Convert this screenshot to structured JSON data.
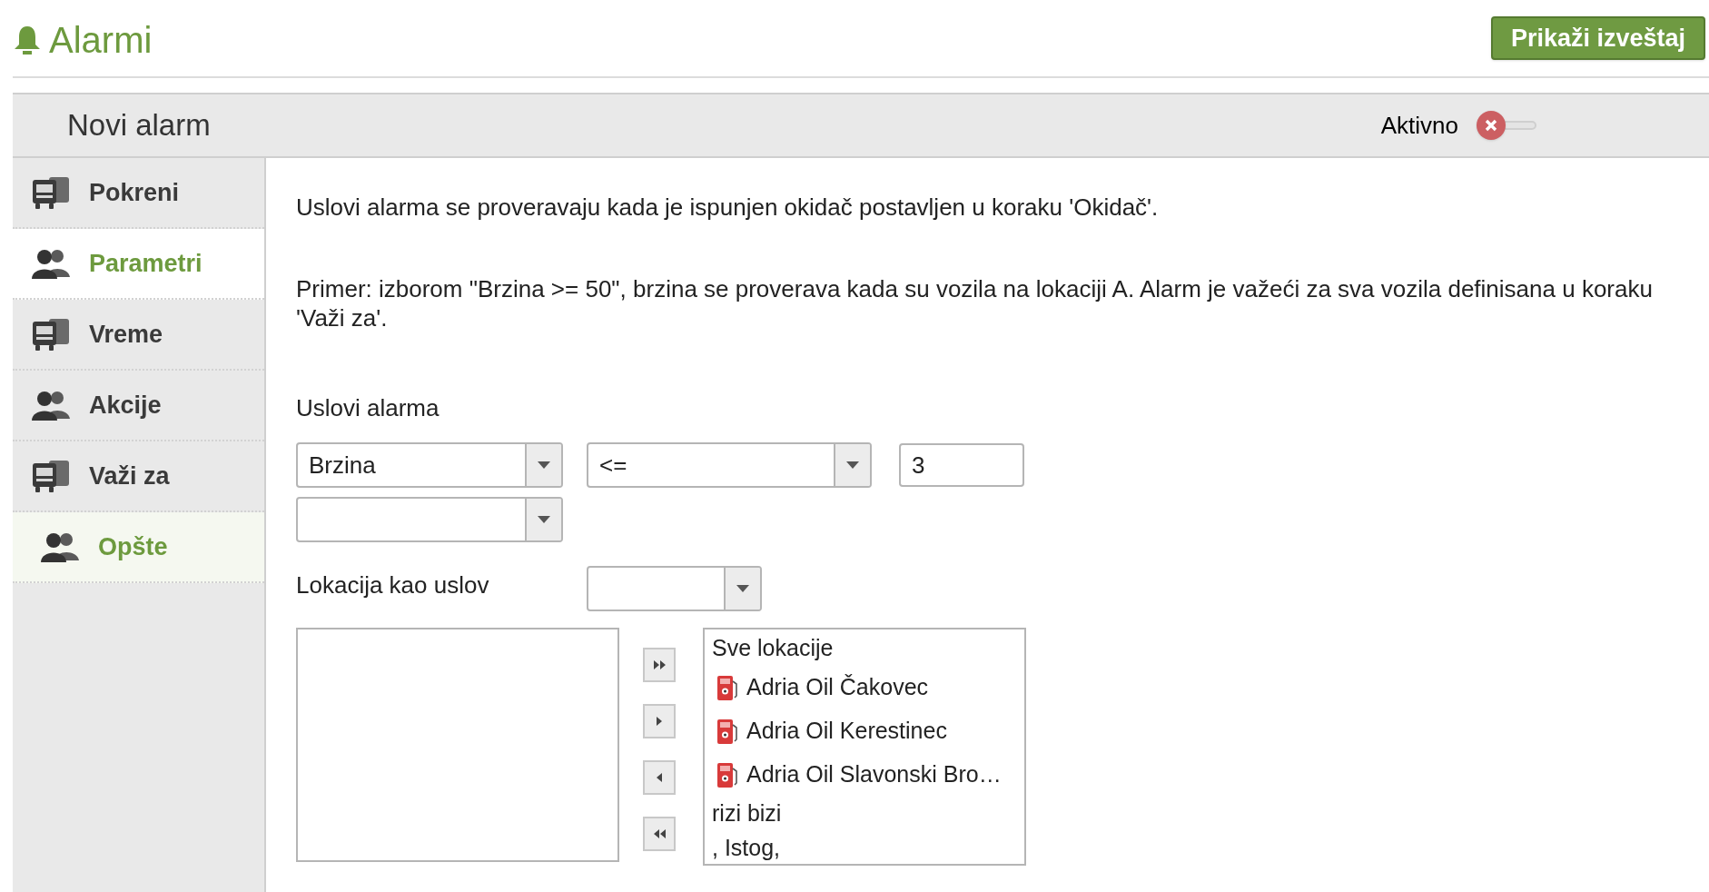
{
  "header": {
    "title": "Alarmi",
    "report_button": "Prikaži izveštaj"
  },
  "panel": {
    "title": "Novi alarm",
    "active_label": "Aktivno",
    "active_on": false
  },
  "sidebar": {
    "items": [
      {
        "label": "Pokreni",
        "kind": "truck",
        "selected": false,
        "highlighted": false
      },
      {
        "label": "Parametri",
        "kind": "people",
        "selected": true,
        "highlighted": false
      },
      {
        "label": "Vreme",
        "kind": "truck",
        "selected": false,
        "highlighted": false
      },
      {
        "label": "Akcije",
        "kind": "people",
        "selected": false,
        "highlighted": false
      },
      {
        "label": "Važi za",
        "kind": "truck",
        "selected": false,
        "highlighted": false
      },
      {
        "label": "Opšte",
        "kind": "people",
        "selected": false,
        "highlighted": true
      }
    ]
  },
  "content": {
    "intro": "Uslovi alarma se proveravaju kada je ispunjen okidač postavljen u koraku 'Okidač'.",
    "example": "Primer: izborom \"Brzina >= 50\", brzina se proverava kada su vozila na lokaciji A. Alarm je važeći za sva vozila definisana u koraku 'Važi za'.",
    "conditions_label": "Uslovi alarma",
    "parameter_value": "Brzina",
    "operator_value": "<=",
    "threshold_value": "3",
    "location_label": "Lokacija kao uslov",
    "available_locations": [
      {
        "kind": "header",
        "label": "Sve lokacije"
      },
      {
        "kind": "fuel",
        "label": "Adria Oil Čakovec"
      },
      {
        "kind": "fuel",
        "label": "Adria Oil Kerestinec"
      },
      {
        "kind": "fuel",
        "label": "Adria Oil Slavonski Bro…"
      },
      {
        "kind": "plain",
        "label": "rizi bizi"
      },
      {
        "kind": "plain",
        "label": ", Istog,"
      }
    ]
  }
}
